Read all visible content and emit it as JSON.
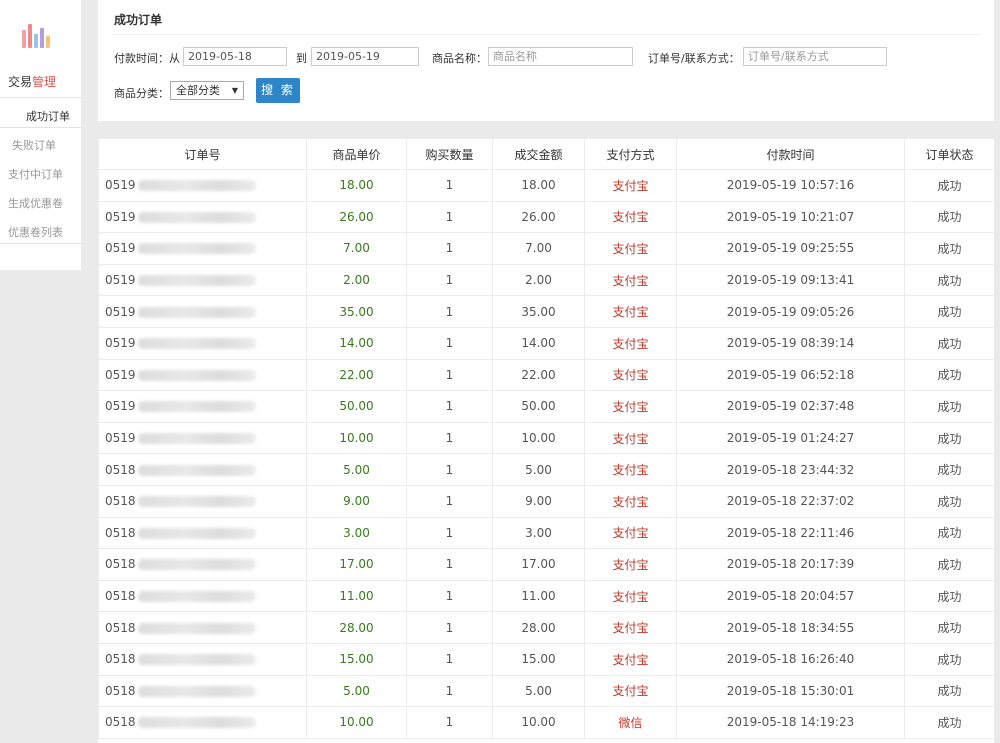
{
  "sidebar": {
    "logo_icon": "bar-chart-logo",
    "title_prefix": "交易",
    "title_highlight": "管理",
    "active_item": "成功订单",
    "items": [
      "失败订单",
      "支付中订单",
      "生成优惠卷",
      "优惠卷列表"
    ]
  },
  "filter": {
    "title": "成功订单",
    "pay_time_label": "付款时间：从",
    "date_from": "2019-05-18",
    "to_label": "到",
    "date_to": "2019-05-19",
    "product_name_label": "商品名称：",
    "product_name_placeholder": "商品名称",
    "order_contact_label": "订单号/联系方式：",
    "order_contact_placeholder": "订单号/联系方式",
    "category_label": "商品分类：",
    "category_selected": "全部分类",
    "search_button": "搜 索"
  },
  "table": {
    "headers": [
      "订单号",
      "商品单价",
      "购买数量",
      "成交金额",
      "支付方式",
      "付款时间",
      "订单状态"
    ],
    "rows": [
      {
        "order": "0519",
        "price": "18.00",
        "qty": "1",
        "amount": "18.00",
        "pay": "支付宝",
        "time": "2019-05-19 10:57:16",
        "status": "成功"
      },
      {
        "order": "0519",
        "price": "26.00",
        "qty": "1",
        "amount": "26.00",
        "pay": "支付宝",
        "time": "2019-05-19 10:21:07",
        "status": "成功"
      },
      {
        "order": "0519",
        "price": "7.00",
        "qty": "1",
        "amount": "7.00",
        "pay": "支付宝",
        "time": "2019-05-19 09:25:55",
        "status": "成功"
      },
      {
        "order": "0519",
        "price": "2.00",
        "qty": "1",
        "amount": "2.00",
        "pay": "支付宝",
        "time": "2019-05-19 09:13:41",
        "status": "成功"
      },
      {
        "order": "0519",
        "price": "35.00",
        "qty": "1",
        "amount": "35.00",
        "pay": "支付宝",
        "time": "2019-05-19 09:05:26",
        "status": "成功"
      },
      {
        "order": "0519",
        "price": "14.00",
        "qty": "1",
        "amount": "14.00",
        "pay": "支付宝",
        "time": "2019-05-19 08:39:14",
        "status": "成功"
      },
      {
        "order": "0519",
        "price": "22.00",
        "qty": "1",
        "amount": "22.00",
        "pay": "支付宝",
        "time": "2019-05-19 06:52:18",
        "status": "成功"
      },
      {
        "order": "0519",
        "price": "50.00",
        "qty": "1",
        "amount": "50.00",
        "pay": "支付宝",
        "time": "2019-05-19 02:37:48",
        "status": "成功"
      },
      {
        "order": "0519",
        "price": "10.00",
        "qty": "1",
        "amount": "10.00",
        "pay": "支付宝",
        "time": "2019-05-19 01:24:27",
        "status": "成功"
      },
      {
        "order": "0518",
        "price": "5.00",
        "qty": "1",
        "amount": "5.00",
        "pay": "支付宝",
        "time": "2019-05-18 23:44:32",
        "status": "成功"
      },
      {
        "order": "0518",
        "price": "9.00",
        "qty": "1",
        "amount": "9.00",
        "pay": "支付宝",
        "time": "2019-05-18 22:37:02",
        "status": "成功"
      },
      {
        "order": "0518",
        "price": "3.00",
        "qty": "1",
        "amount": "3.00",
        "pay": "支付宝",
        "time": "2019-05-18 22:11:46",
        "status": "成功"
      },
      {
        "order": "0518",
        "price": "17.00",
        "qty": "1",
        "amount": "17.00",
        "pay": "支付宝",
        "time": "2019-05-18 20:17:39",
        "status": "成功"
      },
      {
        "order": "0518",
        "price": "11.00",
        "qty": "1",
        "amount": "11.00",
        "pay": "支付宝",
        "time": "2019-05-18 20:04:57",
        "status": "成功"
      },
      {
        "order": "0518",
        "price": "28.00",
        "qty": "1",
        "amount": "28.00",
        "pay": "支付宝",
        "time": "2019-05-18 18:34:55",
        "status": "成功"
      },
      {
        "order": "0518",
        "price": "15.00",
        "qty": "1",
        "amount": "15.00",
        "pay": "支付宝",
        "time": "2019-05-18 16:26:40",
        "status": "成功"
      },
      {
        "order": "0518",
        "price": "5.00",
        "qty": "1",
        "amount": "5.00",
        "pay": "支付宝",
        "time": "2019-05-18 15:30:01",
        "status": "成功"
      },
      {
        "order": "0518",
        "price": "10.00",
        "qty": "1",
        "amount": "10.00",
        "pay": "微信",
        "time": "2019-05-18 14:19:23",
        "status": "成功"
      }
    ]
  },
  "colors": {
    "accent_red": "#d9534f",
    "price_green": "#3a7a1f",
    "pay_red": "#c0392b",
    "button_blue": "#2e86c8"
  }
}
